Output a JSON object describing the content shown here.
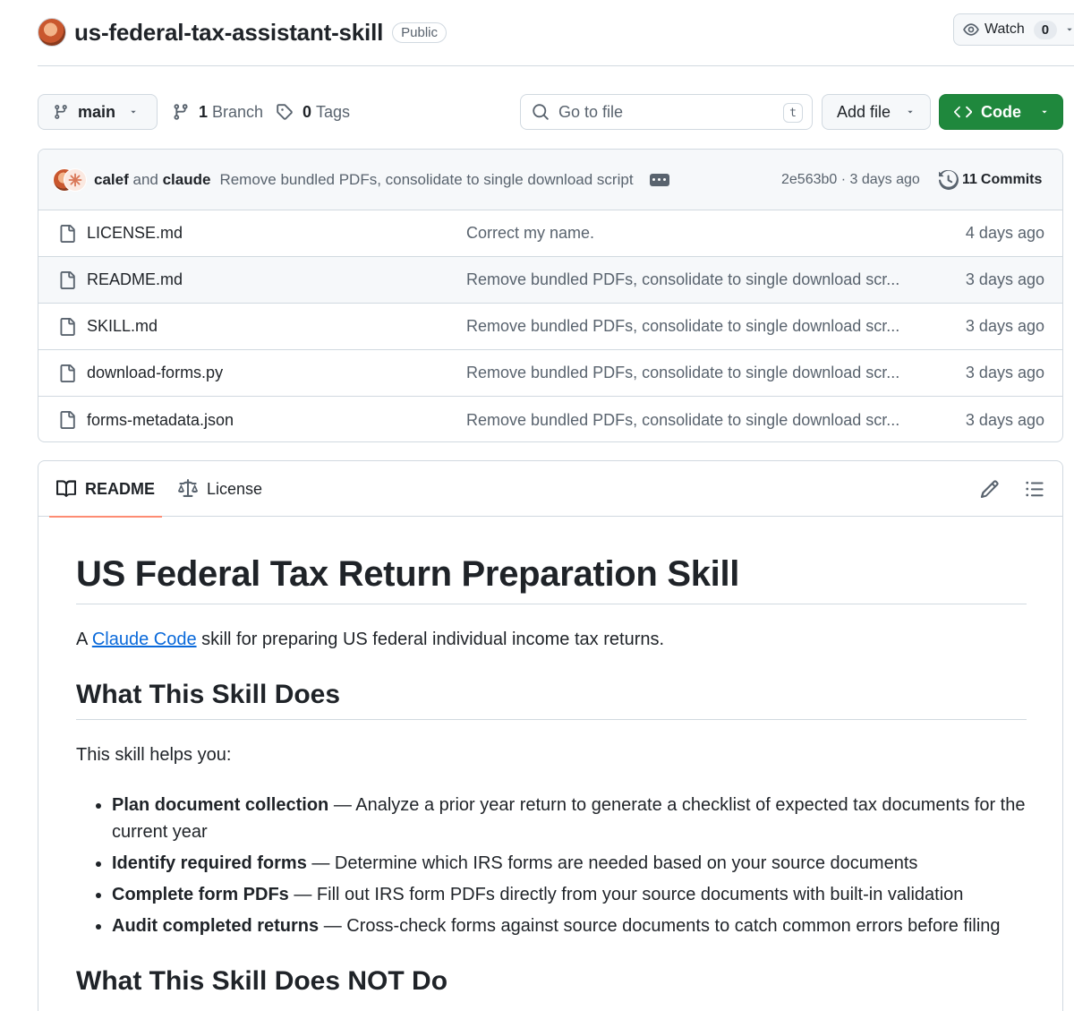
{
  "repo": {
    "name": "us-federal-tax-assistant-skill",
    "visibility": "Public"
  },
  "watch": {
    "label": "Watch",
    "count": "0"
  },
  "toolbar": {
    "branch": "main",
    "branches_count": "1",
    "branches_label": "Branch",
    "tags_count": "0",
    "tags_label": "Tags",
    "goto_placeholder": "Go to file",
    "goto_shortcut": "t",
    "add_file": "Add file",
    "code": "Code"
  },
  "latest_commit": {
    "author1": "calef",
    "joiner": "and",
    "author2": "claude",
    "message": "Remove bundled PDFs, consolidate to single download script",
    "hash_age": "2e563b0 · 3 days ago",
    "commits_count": "11",
    "commits_label": "Commits"
  },
  "files": [
    {
      "name": "LICENSE.md",
      "commit": "Correct my name.",
      "age": "4 days ago"
    },
    {
      "name": "README.md",
      "commit": "Remove bundled PDFs, consolidate to single download scr...",
      "age": "3 days ago"
    },
    {
      "name": "SKILL.md",
      "commit": "Remove bundled PDFs, consolidate to single download scr...",
      "age": "3 days ago"
    },
    {
      "name": "download-forms.py",
      "commit": "Remove bundled PDFs, consolidate to single download scr...",
      "age": "3 days ago"
    },
    {
      "name": "forms-metadata.json",
      "commit": "Remove bundled PDFs, consolidate to single download scr...",
      "age": "3 days ago"
    }
  ],
  "readme_tabs": {
    "readme": "README",
    "license": "License"
  },
  "readme": {
    "title": "US Federal Tax Return Preparation Skill",
    "intro_prefix": "A",
    "intro_link": "Claude Code",
    "intro_suffix": "skill for preparing US federal individual income tax returns.",
    "h2_does": "What This Skill Does",
    "helps": "This skill helps you:",
    "bullets": [
      {
        "bold": "Plan document collection",
        "text": " — Analyze a prior year return to generate a checklist of expected tax documents for the current year"
      },
      {
        "bold": "Identify required forms",
        "text": " — Determine which IRS forms are needed based on your source documents"
      },
      {
        "bold": "Complete form PDFs",
        "text": " — Fill out IRS form PDFs directly from your source documents with built-in validation"
      },
      {
        "bold": "Audit completed returns",
        "text": " — Cross-check forms against source documents to catch common errors before filing"
      }
    ],
    "h2_not": "What This Skill Does NOT Do"
  },
  "colors": {
    "accent_green": "#1f883d",
    "link_blue": "#0969da",
    "tab_underline": "#fd8c73"
  }
}
